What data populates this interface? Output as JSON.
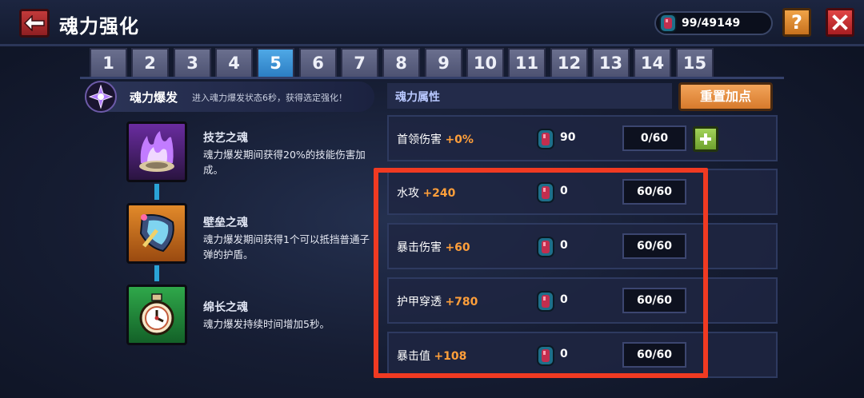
{
  "header": {
    "title": "魂力强化",
    "currency": "99/49149"
  },
  "tabs": [
    "1",
    "2",
    "3",
    "4",
    "5",
    "6",
    "7",
    "8",
    "9",
    "10",
    "11",
    "12",
    "13",
    "14",
    "15"
  ],
  "active_tab": "5",
  "burst": {
    "title": "魂力爆发",
    "desc": "进入魂力爆发状态6秒，获得选定强化！"
  },
  "skills": [
    {
      "name": "技艺之魂",
      "desc": "魂力爆发期间获得20%的技能伤害加成。"
    },
    {
      "name": "壁垒之魂",
      "desc": "魂力爆发期间获得1个可以抵挡普通子弹的护盾。"
    },
    {
      "name": "绵长之魂",
      "desc": "魂力爆发持续时间增加5秒。"
    }
  ],
  "attributes": {
    "title": "魂力属性",
    "reset_label": "重置加点",
    "rows": [
      {
        "name": "首领伤害",
        "bonus": "+0%",
        "cost": "90",
        "progress": "0/60"
      },
      {
        "name": "水攻",
        "bonus": "+240",
        "cost": "0",
        "progress": "60/60"
      },
      {
        "name": "暴击伤害",
        "bonus": "+60",
        "cost": "0",
        "progress": "60/60"
      },
      {
        "name": "护甲穿透",
        "bonus": "+780",
        "cost": "0",
        "progress": "60/60"
      },
      {
        "name": "暴击值",
        "bonus": "+108",
        "cost": "0",
        "progress": "60/60"
      }
    ]
  },
  "colors": {
    "accent_orange": "#ff9f3a",
    "highlight_red": "#f03a22",
    "active_tab_blue": "#2c7ec4"
  }
}
